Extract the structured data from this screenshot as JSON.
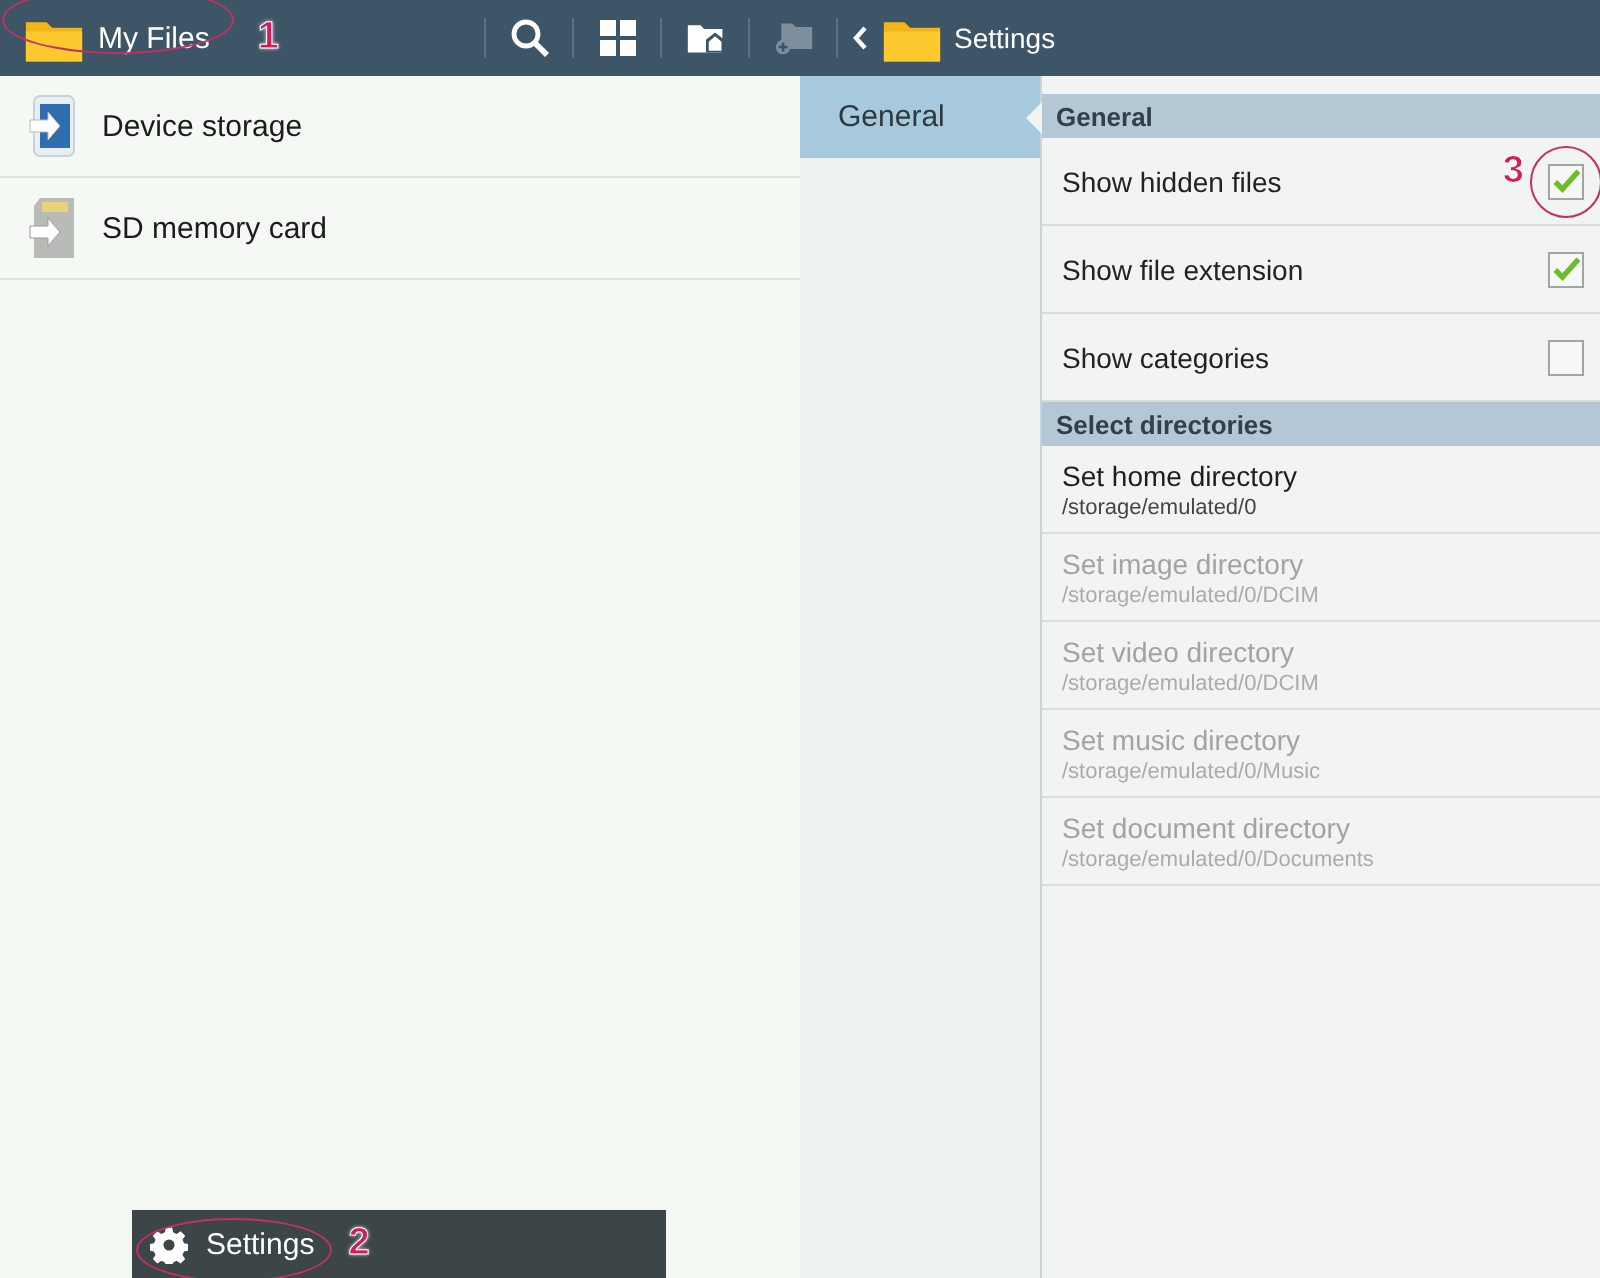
{
  "top_bar": {
    "title": "My Files",
    "title_annotation": "1",
    "tools": [
      {
        "kind": "search",
        "disabled": false
      },
      {
        "kind": "grid",
        "disabled": false
      },
      {
        "kind": "home-folder",
        "disabled": false
      },
      {
        "kind": "add-folder",
        "disabled": true
      }
    ],
    "settings_title": "Settings"
  },
  "storage_list": [
    {
      "kind": "device",
      "label": "Device storage"
    },
    {
      "kind": "sd",
      "label": "SD memory card"
    }
  ],
  "settings_nav": [
    {
      "label": "General",
      "selected": true
    }
  ],
  "sections": [
    {
      "title": "General",
      "rows": [
        {
          "kind": "checkbox",
          "label": "Show hidden files",
          "checked": true,
          "annotation": "3"
        },
        {
          "kind": "checkbox",
          "label": "Show file extension",
          "checked": true
        },
        {
          "kind": "checkbox",
          "label": "Show categories",
          "checked": false
        }
      ]
    },
    {
      "title": "Select directories",
      "rows": [
        {
          "kind": "directory",
          "label": "Set home directory",
          "path": "/storage/emulated/0",
          "disabled": false
        },
        {
          "kind": "directory",
          "label": "Set image directory",
          "path": "/storage/emulated/0/DCIM",
          "disabled": true
        },
        {
          "kind": "directory",
          "label": "Set video directory",
          "path": "/storage/emulated/0/DCIM",
          "disabled": true
        },
        {
          "kind": "directory",
          "label": "Set music directory",
          "path": "/storage/emulated/0/Music",
          "disabled": true
        },
        {
          "kind": "directory",
          "label": "Set document directory",
          "path": "/storage/emulated/0/Documents",
          "disabled": true
        }
      ]
    }
  ],
  "popup_menu": {
    "label": "Settings",
    "annotation": "2"
  }
}
